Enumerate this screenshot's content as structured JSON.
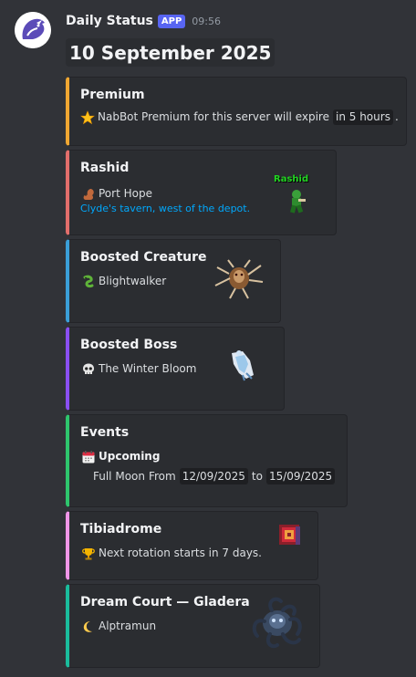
{
  "message": {
    "username": "Daily Status",
    "badge": "APP",
    "timestamp": "09:56",
    "avatar_icon": "dragon-avatar-icon"
  },
  "title": "10 September 2025",
  "colors": {
    "premium": "#f0a732",
    "rashid": "#e26e6b",
    "creature": "#3a9fd8",
    "boss": "#8a4ff2",
    "events": "#2ec56d",
    "tibiadrome": "#f096e8",
    "dream": "#1abc9c"
  },
  "embeds": {
    "premium": {
      "title": "Premium",
      "icon": "star-icon",
      "text_before": "NabBot Premium for this server will expire",
      "code": "in 5 hours",
      "text_after": "."
    },
    "rashid": {
      "title": "Rashid",
      "icon": "squirrel-icon",
      "location": "Port Hope",
      "detail": "Clyde's tavern, west of the depot.",
      "sprite_label": "Rashid"
    },
    "creature": {
      "title": "Boosted Creature",
      "icon": "serpent-icon",
      "name": "Blightwalker"
    },
    "boss": {
      "title": "Boosted Boss",
      "icon": "skull-icon",
      "name": "The Winter Bloom"
    },
    "events": {
      "title": "Events",
      "icon": "calendar-icon",
      "heading": "Upcoming",
      "item_name": "Full Moon",
      "item_from": "From",
      "date_start": "12/09/2025",
      "item_to": "to",
      "date_end": "15/09/2025"
    },
    "tibiadrome": {
      "title": "Tibiadrome",
      "icon": "trophy-icon",
      "text": "Next rotation starts in 7 days."
    },
    "dream": {
      "title": "Dream Court — Gladera",
      "icon": "moon-icon",
      "name": "Alptramun"
    }
  }
}
